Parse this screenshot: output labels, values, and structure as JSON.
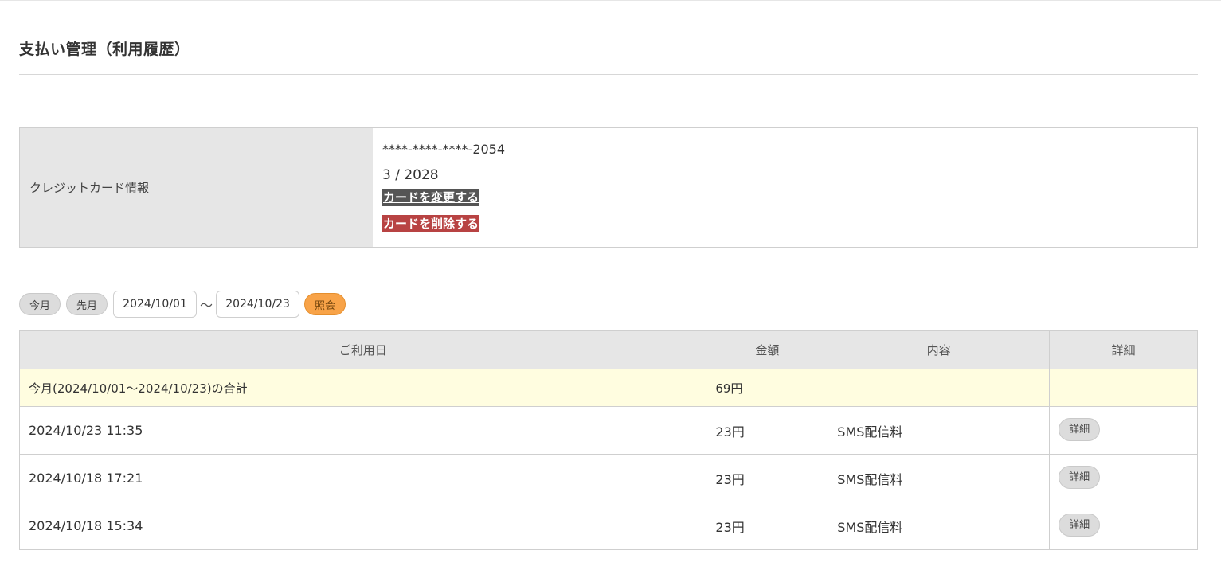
{
  "page": {
    "title": "支払い管理（利用履歴）"
  },
  "card": {
    "label": "クレジットカード情報",
    "number": "****-****-****-2054",
    "expiry": "3 / 2028",
    "change_label": "カードを変更する",
    "delete_label": "カードを削除する"
  },
  "filter": {
    "this_month_label": "今月",
    "last_month_label": "先月",
    "start_date": "2024/10/01",
    "separator": "〜",
    "end_date": "2024/10/23",
    "search_label": "照会"
  },
  "table": {
    "headers": {
      "date": "ご利用日",
      "amount": "金額",
      "description": "内容",
      "detail": "詳細"
    },
    "total": {
      "label": "今月(2024/10/01〜2024/10/23)の合計",
      "amount": "69円"
    },
    "rows": [
      {
        "date": "2024/10/23 11:35",
        "amount": "23円",
        "description": "SMS配信料",
        "detail_label": "詳細"
      },
      {
        "date": "2024/10/18 17:21",
        "amount": "23円",
        "description": "SMS配信料",
        "detail_label": "詳細"
      },
      {
        "date": "2024/10/18 15:34",
        "amount": "23円",
        "description": "SMS配信料",
        "detail_label": "詳細"
      }
    ]
  },
  "colors": {
    "header_bg": "#e6e6e6",
    "total_row_bg": "#fffde0",
    "change_button_bg": "#555555",
    "delete_button_bg": "#b84343",
    "search_button_bg": "#f8a348"
  }
}
